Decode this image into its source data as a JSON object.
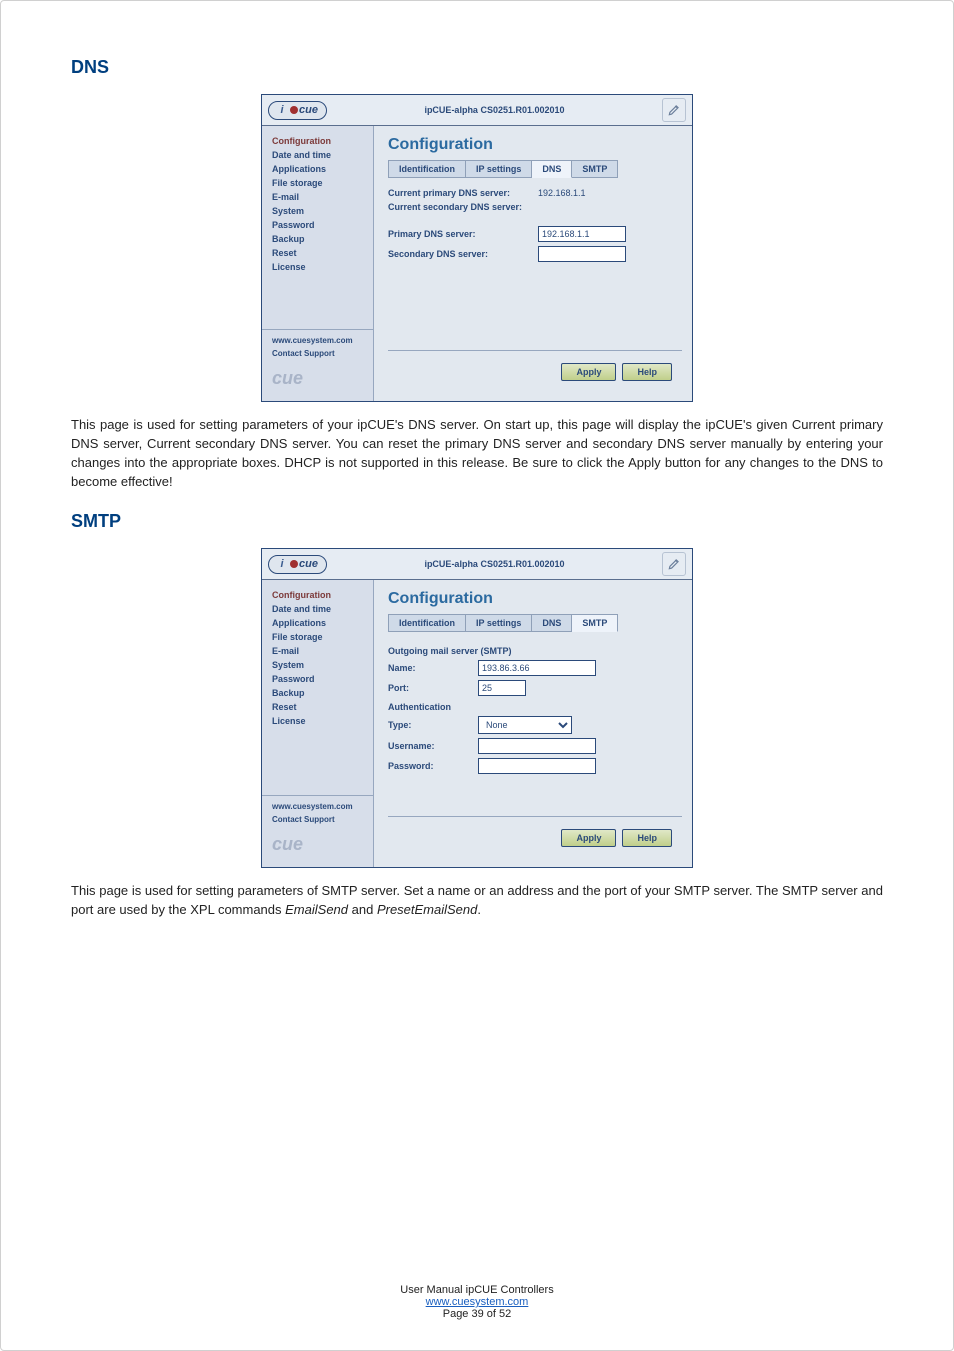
{
  "headings": {
    "dns": "DNS",
    "smtp": "SMTP"
  },
  "header_title": "ipCUE-alpha  CS0251.R01.002010",
  "sidebar": {
    "items": [
      {
        "label": "Configuration",
        "sel": true
      },
      {
        "label": "Date and time"
      },
      {
        "label": "Applications"
      },
      {
        "label": "File storage"
      },
      {
        "label": "E-mail"
      },
      {
        "label": "System"
      },
      {
        "label": "Password"
      },
      {
        "label": "Backup"
      },
      {
        "label": "Reset"
      },
      {
        "label": "License"
      }
    ],
    "link_site": "www.cuesystem.com",
    "link_support": "Contact Support",
    "brand": "cue"
  },
  "tabs": {
    "id": "Identification",
    "ip": "IP settings",
    "dns": "DNS",
    "smtp": "SMTP"
  },
  "cfg_title": "Configuration",
  "buttons": {
    "apply": "Apply",
    "help": "Help"
  },
  "dns_panel": {
    "cur_primary_lbl": "Current primary DNS server:",
    "cur_primary_val": "192.168.1.1",
    "cur_secondary_lbl": "Current secondary DNS server:",
    "primary_lbl": "Primary DNS server:",
    "primary_val": "192.168.1.1",
    "secondary_lbl": "Secondary DNS server:",
    "secondary_val": ""
  },
  "smtp_panel": {
    "section": "Outgoing mail server (SMTP)",
    "name_lbl": "Name:",
    "name_val": "193.86.3.66",
    "port_lbl": "Port:",
    "port_val": "25",
    "auth_section": "Authentication",
    "type_lbl": "Type:",
    "type_val": "None",
    "user_lbl": "Username:",
    "user_val": "",
    "pass_lbl": "Password:",
    "pass_val": ""
  },
  "para_dns": "This page is used for setting parameters of your ipCUE's DNS server. On start up, this page will display the ipCUE's given Current primary DNS server, Current secondary DNS server. You can reset the primary DNS server and secondary DNS server manually by entering your changes into the appropriate boxes. DHCP is not supported in this release. Be sure to click the Apply button for any changes to the DNS to become effective!",
  "para_smtp_a": "This page is used for setting parameters of SMTP server. Set a name or an address and the port of your SMTP server. The SMTP server and port are used by the XPL commands ",
  "para_smtp_b": "EmailSend",
  "para_smtp_c": " and ",
  "para_smtp_d": "PresetEmailSend",
  "para_smtp_e": ".",
  "footer": {
    "line1": "User Manual ipCUE Controllers",
    "link": "www.cuesystem.com",
    "page": "Page 39 of 52"
  }
}
